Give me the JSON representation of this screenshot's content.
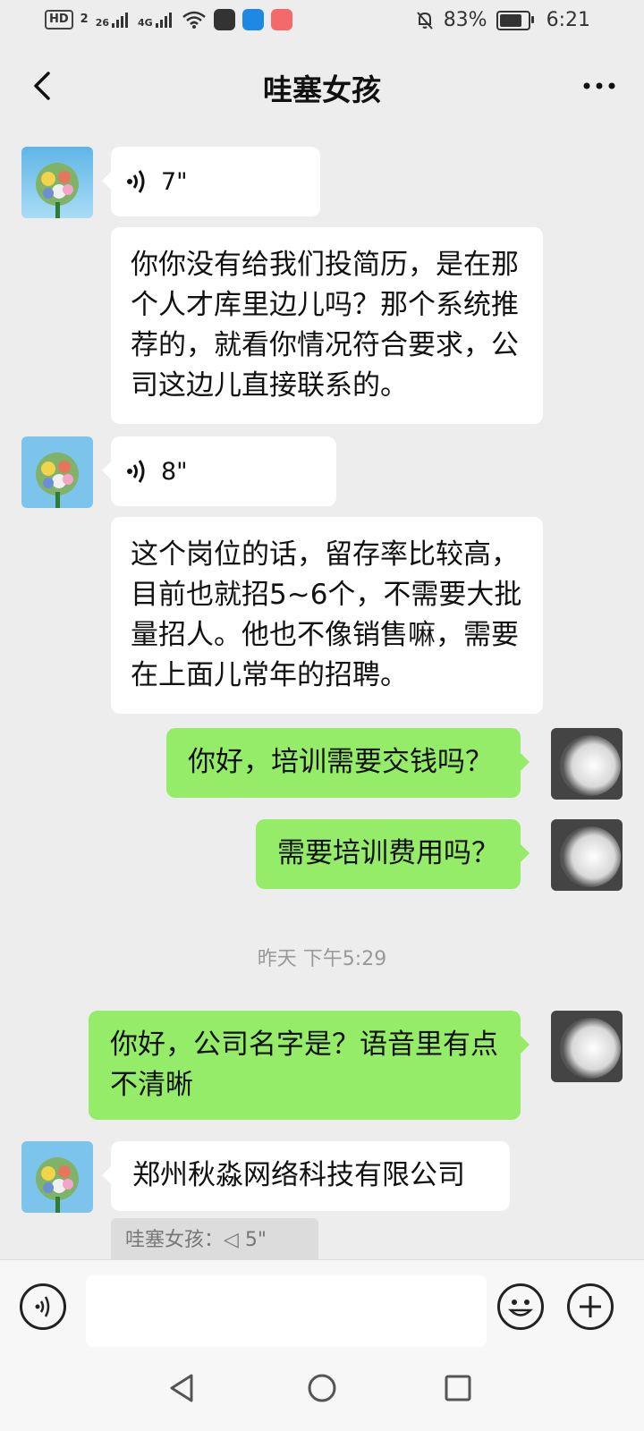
{
  "status_bar": {
    "hd": "HD",
    "sim2": "2",
    "net1": "26",
    "net2": "4G",
    "battery_pct": "83%",
    "battery_level": 0.83,
    "time": "6:21"
  },
  "header": {
    "title": "哇塞女孩"
  },
  "messages": [
    {
      "side": "left",
      "type": "voice",
      "duration": "7\""
    },
    {
      "side": "left",
      "type": "text",
      "text": "你你没有给我们投简历，是在那个人才库里边儿吗？那个系统推荐的，就看你情况符合要求，公司这边儿直接联系的。"
    },
    {
      "side": "left",
      "type": "voice",
      "duration": "8\""
    },
    {
      "side": "left",
      "type": "text",
      "text": "这个岗位的话，留存率比较高，目前也就招5~6个，不需要大批量招人。他也不像销售嘛，需要在上面儿常年的招聘。"
    },
    {
      "side": "right",
      "type": "text",
      "text": "你好，培训需要交钱吗？"
    },
    {
      "side": "right",
      "type": "text",
      "text": "需要培训费用吗？"
    },
    {
      "type": "time",
      "text": "昨天 下午5:29"
    },
    {
      "side": "right",
      "type": "text",
      "text": "你好，公司名字是？语音里有点不清晰"
    },
    {
      "side": "left",
      "type": "text",
      "text": "郑州秋淼网络科技有限公司"
    },
    {
      "side": "left",
      "type": "quote",
      "text": "哇塞女孩：◁ 5\""
    }
  ],
  "colors": {
    "background": "#ededed",
    "green_bubble": "#95ec69",
    "white_bubble": "#ffffff"
  },
  "icons": {
    "back": "back-arrow-icon",
    "more": "more-dots-icon",
    "voice_toggle": "voice-icon",
    "emoji": "emoji-icon",
    "plus": "plus-icon"
  }
}
